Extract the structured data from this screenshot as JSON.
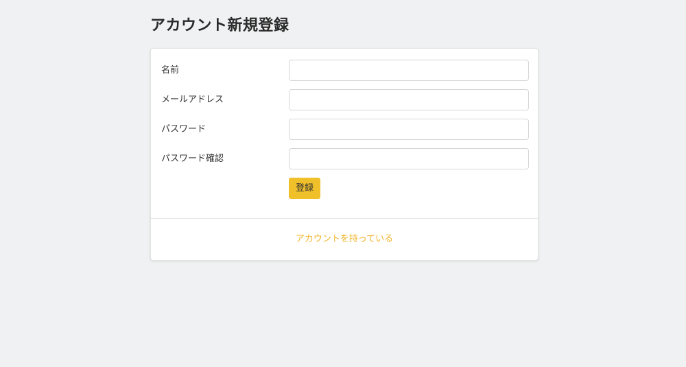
{
  "page": {
    "title": "アカウント新規登録"
  },
  "form": {
    "fields": [
      {
        "label": "名前",
        "value": "",
        "type": "text"
      },
      {
        "label": "メールアドレス",
        "value": "",
        "type": "email"
      },
      {
        "label": "パスワード",
        "value": "",
        "type": "password"
      },
      {
        "label": "パスワード確認",
        "value": "",
        "type": "password"
      }
    ],
    "submit_label": "登録"
  },
  "footer": {
    "login_link_label": "アカウントを持っている"
  },
  "colors": {
    "background": "#f0f1f2",
    "accent": "#f0c02a",
    "link": "#f0b529"
  }
}
